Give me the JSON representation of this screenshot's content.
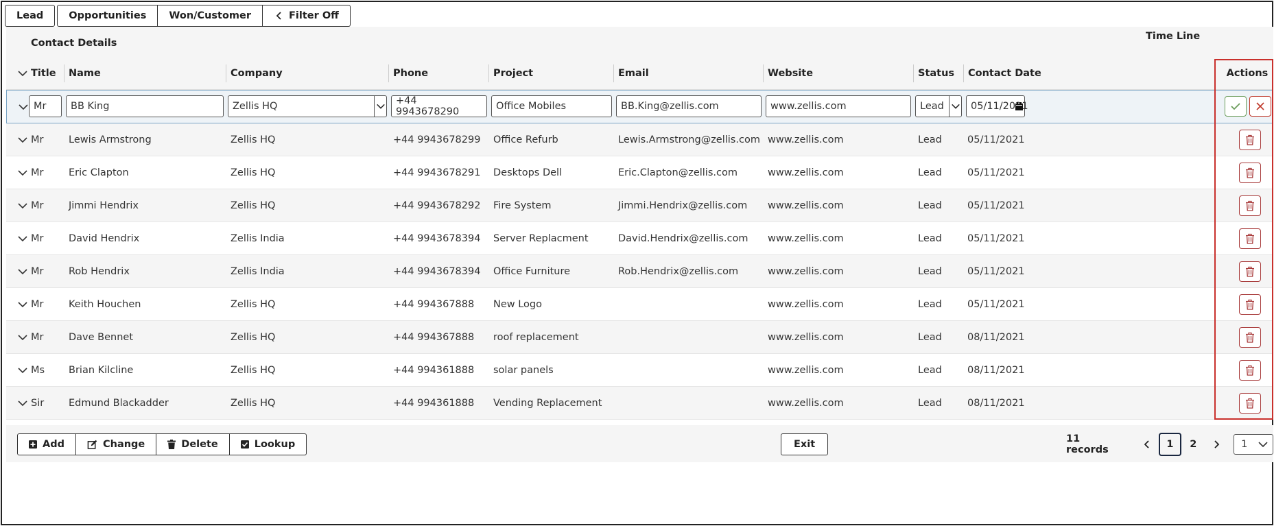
{
  "tabs": [
    {
      "label": "Lead"
    },
    {
      "label": "Opportunities"
    },
    {
      "label": "Won/Customer"
    },
    {
      "label": "Filter Off"
    }
  ],
  "header": {
    "group_contact": "Contact Details",
    "group_timeline": "Time Line",
    "columns": {
      "title": "Title",
      "name": "Name",
      "company": "Company",
      "phone": "Phone",
      "project": "Project",
      "email": "Email",
      "website": "Website",
      "status": "Status",
      "contact_date": "Contact Date",
      "actions": "Actions"
    }
  },
  "edit_row": {
    "title": "Mr",
    "name": "BB King",
    "company": "Zellis HQ",
    "phone": "+44 9943678290",
    "project": "Office Mobiles",
    "email": "BB.King@zellis.com",
    "website": "www.zellis.com",
    "status": "Lead",
    "contact_date": "05/11/2021"
  },
  "rows": [
    {
      "title": "Mr",
      "name": "Lewis Armstrong",
      "company": "Zellis HQ",
      "phone": "+44 9943678299",
      "project": "Office Refurb",
      "email": "Lewis.Armstrong@zellis.com",
      "website": "www.zellis.com",
      "status": "Lead",
      "contact_date": "05/11/2021"
    },
    {
      "title": "Mr",
      "name": "Eric Clapton",
      "company": "Zellis HQ",
      "phone": "+44 9943678291",
      "project": "Desktops Dell",
      "email": "Eric.Clapton@zellis.com",
      "website": "www.zellis.com",
      "status": "Lead",
      "contact_date": "05/11/2021"
    },
    {
      "title": "Mr",
      "name": "Jimmi Hendrix",
      "company": "Zellis HQ",
      "phone": "+44 9943678292",
      "project": "Fire System",
      "email": "Jimmi.Hendrix@zellis.com",
      "website": "www.zellis.com",
      "status": "Lead",
      "contact_date": "05/11/2021"
    },
    {
      "title": "Mr",
      "name": "David Hendrix",
      "company": "Zellis India",
      "phone": "+44 9943678394",
      "project": "Server Replacment",
      "email": "David.Hendrix@zellis.com",
      "website": "www.zellis.com",
      "status": "Lead",
      "contact_date": "05/11/2021"
    },
    {
      "title": "Mr",
      "name": "Rob Hendrix",
      "company": "Zellis India",
      "phone": "+44 9943678394",
      "project": "Office Furniture",
      "email": "Rob.Hendrix@zellis.com",
      "website": "www.zellis.com",
      "status": "Lead",
      "contact_date": "05/11/2021"
    },
    {
      "title": "Mr",
      "name": "Keith Houchen",
      "company": "Zellis HQ",
      "phone": "+44 994367888",
      "project": "New Logo",
      "email": "",
      "website": "www.zellis.com",
      "status": "Lead",
      "contact_date": "05/11/2021"
    },
    {
      "title": "Mr",
      "name": "Dave Bennet",
      "company": "Zellis HQ",
      "phone": "+44 994367888",
      "project": "roof replacement",
      "email": "",
      "website": "www.zellis.com",
      "status": "Lead",
      "contact_date": "08/11/2021"
    },
    {
      "title": "Ms",
      "name": "Brian Kilcline",
      "company": "Zellis HQ",
      "phone": "+44 994361888",
      "project": "solar panels",
      "email": "",
      "website": "www.zellis.com",
      "status": "Lead",
      "contact_date": "08/11/2021"
    },
    {
      "title": "Sir",
      "name": "Edmund Blackadder",
      "company": "Zellis HQ",
      "phone": "+44 994361888",
      "project": "Vending Replacement",
      "email": "",
      "website": "www.zellis.com",
      "status": "Lead",
      "contact_date": "08/11/2021"
    }
  ],
  "footer": {
    "add": "Add",
    "change": "Change",
    "delete": "Delete",
    "lookup": "Lookup",
    "exit": "Exit",
    "records": "11 records",
    "pages": [
      "1",
      "2"
    ],
    "current_page": "1",
    "page_select": "1"
  },
  "colors": {
    "confirm": "#6a9c5a",
    "cancel": "#c0392b",
    "delete": "#a83a3a",
    "highlight": "#c9302c"
  }
}
